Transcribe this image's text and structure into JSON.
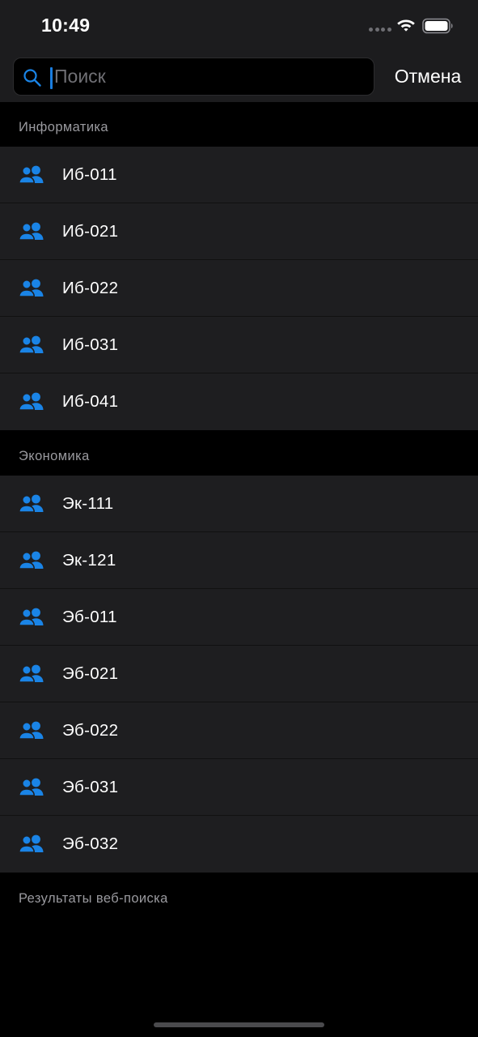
{
  "status_bar": {
    "time": "10:49",
    "signal_icon": "signal-dots-icon",
    "wifi_icon": "wifi-icon",
    "battery_icon": "battery-icon"
  },
  "search": {
    "placeholder": "Поиск",
    "value": "",
    "icon": "search-icon",
    "cancel_label": "Отмена"
  },
  "sections": [
    {
      "title": "Информатика",
      "items": [
        {
          "label": "Иб-011",
          "icon": "people-icon"
        },
        {
          "label": "Иб-021",
          "icon": "people-icon"
        },
        {
          "label": "Иб-022",
          "icon": "people-icon"
        },
        {
          "label": "Иб-031",
          "icon": "people-icon"
        },
        {
          "label": "Иб-041",
          "icon": "people-icon"
        }
      ]
    },
    {
      "title": "Экономика",
      "items": [
        {
          "label": "Эк-111",
          "icon": "people-icon"
        },
        {
          "label": "Эк-121",
          "icon": "people-icon"
        },
        {
          "label": "Эб-011",
          "icon": "people-icon"
        },
        {
          "label": "Эб-021",
          "icon": "people-icon"
        },
        {
          "label": "Эб-022",
          "icon": "people-icon"
        },
        {
          "label": "Эб-031",
          "icon": "people-icon"
        },
        {
          "label": "Эб-032",
          "icon": "people-icon"
        }
      ]
    },
    {
      "title": "Результаты веб-поиска",
      "items": []
    }
  ],
  "colors": {
    "accent": "#1a84e6",
    "background": "#000000",
    "row_background": "#1e1e20",
    "header_background": "#1c1c1e",
    "section_text": "#9a9a9f"
  }
}
